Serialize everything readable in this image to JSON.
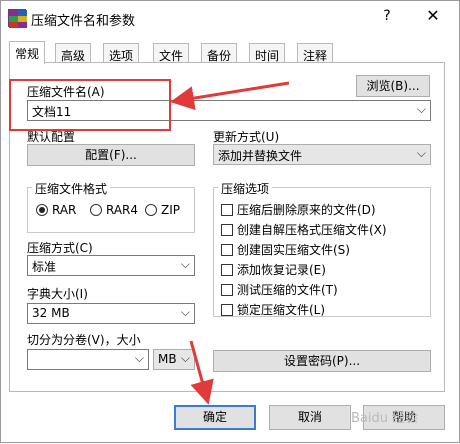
{
  "window": {
    "title": "压缩文件名和参数",
    "help_glyph": "?",
    "close_glyph": "✕"
  },
  "tabs": [
    {
      "label": "常规",
      "active": true
    },
    {
      "label": "高级"
    },
    {
      "label": "选项"
    },
    {
      "label": "文件"
    },
    {
      "label": "备份"
    },
    {
      "label": "时间"
    },
    {
      "label": "注释"
    }
  ],
  "archive_name": {
    "label": "压缩文件名(A)",
    "value": "文档11",
    "browse_label": "浏览(B)..."
  },
  "profiles": {
    "label": "默认配置",
    "button_label": "配置(F)..."
  },
  "update_mode": {
    "label": "更新方式(U)",
    "value": "添加并替换文件"
  },
  "archive_format": {
    "label": "压缩文件格式",
    "options": [
      {
        "label": "RAR",
        "selected": true
      },
      {
        "label": "RAR4",
        "selected": false
      },
      {
        "label": "ZIP",
        "selected": false
      }
    ]
  },
  "compression_method": {
    "label": "压缩方式(C)",
    "value": "标准"
  },
  "dictionary_size": {
    "label": "字典大小(I)",
    "value": "32 MB"
  },
  "split_volumes": {
    "label": "切分为分卷(V)，大小",
    "value": "",
    "unit": "MB"
  },
  "archiving_options": {
    "label": "压缩选项",
    "items": [
      {
        "label": "压缩后删除原来的文件(D)",
        "checked": false
      },
      {
        "label": "创建自解压格式压缩文件(X)",
        "checked": false
      },
      {
        "label": "创建固实压缩文件(S)",
        "checked": false
      },
      {
        "label": "添加恢复记录(E)",
        "checked": false
      },
      {
        "label": "测试压缩的文件(T)",
        "checked": false
      },
      {
        "label": "锁定压缩文件(L)",
        "checked": false
      }
    ]
  },
  "set_password_label": "设置密码(P)...",
  "footer": {
    "ok_label": "确定",
    "cancel_label": "取消",
    "help_label": "帮助"
  },
  "watermark": "Baidu 经验",
  "colors": {
    "annotation": "#e03a3a",
    "accent": "#3b7bd4"
  }
}
